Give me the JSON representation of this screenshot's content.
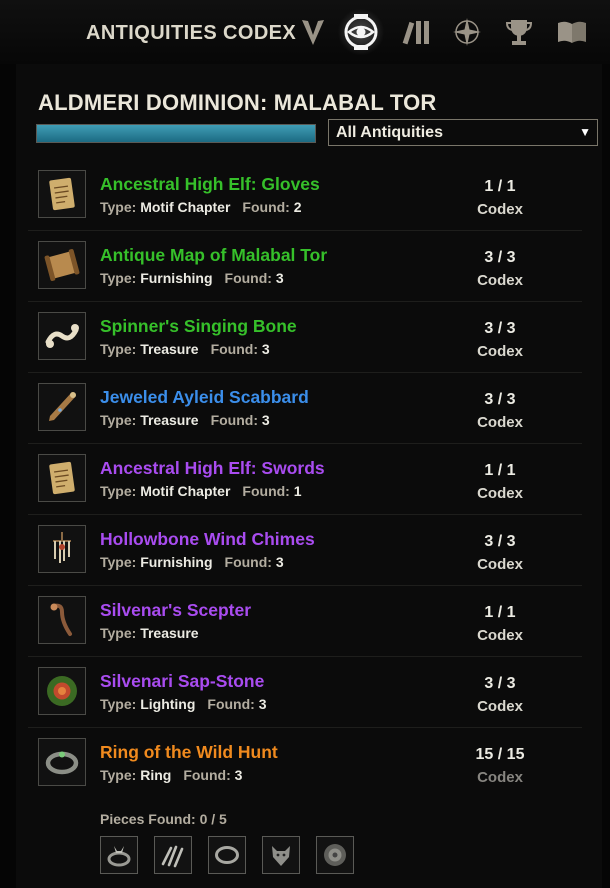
{
  "header": {
    "title": "ANTIQUITIES CODEX",
    "tabs": [
      {
        "icon": "crest-icon"
      },
      {
        "icon": "antiquity-scan-icon",
        "active": true
      },
      {
        "icon": "books-icon"
      },
      {
        "icon": "star-compass-icon"
      },
      {
        "icon": "trophy-icon"
      },
      {
        "icon": "open-book-icon"
      }
    ]
  },
  "zone": {
    "title": "ALDMERI DOMINION: MALABAL TOR",
    "progress": 1.0
  },
  "filter": {
    "selected": "All Antiquities",
    "arrow": "▼"
  },
  "antiquities": [
    {
      "name": "Ancestral High Elf: Gloves",
      "color": "#36c02a",
      "type_label": "Type:",
      "type": "Motif Chapter",
      "found_label": "Found:",
      "found": "2",
      "count": "1 / 1",
      "codex": "Codex",
      "icon": "scroll-icon"
    },
    {
      "name": "Antique Map of Malabal Tor",
      "color": "#36c02a",
      "type_label": "Type:",
      "type": "Furnishing",
      "found_label": "Found:",
      "found": "3",
      "count": "3 / 3",
      "codex": "Codex",
      "icon": "map-icon"
    },
    {
      "name": "Spinner's Singing Bone",
      "color": "#36c02a",
      "type_label": "Type:",
      "type": "Treasure",
      "found_label": "Found:",
      "found": "3",
      "count": "3 / 3",
      "codex": "Codex",
      "icon": "bone-icon"
    },
    {
      "name": "Jeweled Ayleid Scabbard",
      "color": "#3b8eea",
      "type_label": "Type:",
      "type": "Treasure",
      "found_label": "Found:",
      "found": "3",
      "count": "3 / 3",
      "codex": "Codex",
      "icon": "scabbard-icon"
    },
    {
      "name": "Ancestral High Elf: Swords",
      "color": "#a94cf0",
      "type_label": "Type:",
      "type": "Motif Chapter",
      "found_label": "Found:",
      "found": "1",
      "count": "1 / 1",
      "codex": "Codex",
      "icon": "scroll-icon"
    },
    {
      "name": "Hollowbone Wind Chimes",
      "color": "#a94cf0",
      "type_label": "Type:",
      "type": "Furnishing",
      "found_label": "Found:",
      "found": "3",
      "count": "3 / 3",
      "codex": "Codex",
      "icon": "wind-chimes-icon"
    },
    {
      "name": "Silvenar's Scepter",
      "color": "#a94cf0",
      "type_label": "Type:",
      "type": "Treasure",
      "found_label": "",
      "found": "",
      "count": "1 / 1",
      "codex": "Codex",
      "icon": "scepter-icon"
    },
    {
      "name": "Silvenari Sap-Stone",
      "color": "#a94cf0",
      "type_label": "Type:",
      "type": "Lighting",
      "found_label": "Found:",
      "found": "3",
      "count": "3 / 3",
      "codex": "Codex",
      "icon": "sap-stone-icon"
    },
    {
      "name": "Ring of the Wild Hunt",
      "color": "#f08a1e",
      "type_label": "Type:",
      "type": "Ring",
      "found_label": "Found:",
      "found": "3",
      "count": "15 / 15",
      "codex": "Codex",
      "icon": "ring-icon",
      "expanded": true,
      "pieces_label": "Pieces Found: 0 / 5",
      "pieces": [
        "wolf-ring-icon",
        "claw-icon",
        "band-icon",
        "wolf-head-icon",
        "beast-seal-icon"
      ]
    }
  ]
}
